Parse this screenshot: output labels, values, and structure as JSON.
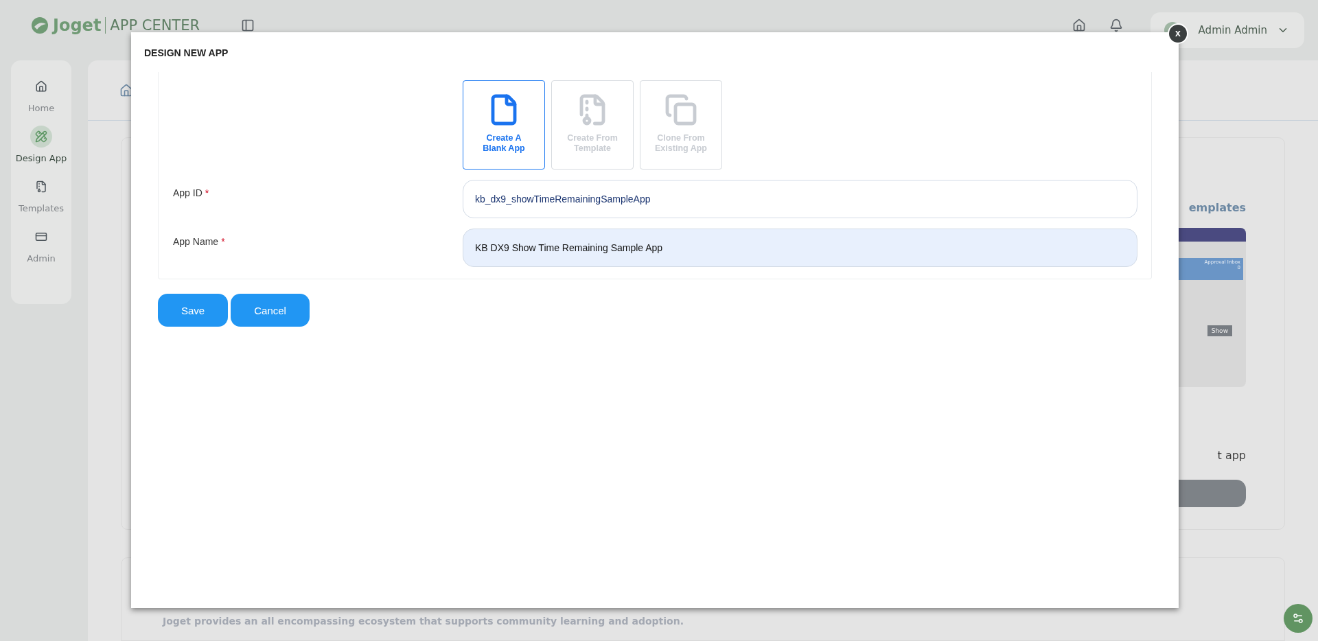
{
  "header": {
    "logo": "Joget",
    "title": "APP CENTER",
    "user": "Admin Admin"
  },
  "sidebar": {
    "items": [
      {
        "label": "Home",
        "selected": false
      },
      {
        "label": "Design App",
        "selected": true
      },
      {
        "label": "Templates",
        "selected": false
      },
      {
        "label": "Admin",
        "selected": false
      }
    ]
  },
  "background": {
    "templates_link": "emplates",
    "preview": {
      "tile_title": "Approval Inbox",
      "tile_count": "0",
      "button": "Show"
    },
    "card_title": "t app",
    "community_text": "Joget provides an all encompassing ecosystem that supports community learning and adoption."
  },
  "dialog": {
    "title": "DESIGN NEW APP",
    "close": "x",
    "options": [
      {
        "label": "Create A Blank App",
        "selected": true,
        "disabled": false
      },
      {
        "label": "Create From Template",
        "selected": false,
        "disabled": true
      },
      {
        "label": "Clone From Existing App",
        "selected": false,
        "disabled": true
      }
    ],
    "fields": [
      {
        "label": "App ID",
        "required_mark": "*",
        "value": "kb_dx9_showTimeRemainingSampleApp",
        "highlighted": false
      },
      {
        "label": "App Name",
        "required_mark": "*",
        "value": "KB DX9 Show Time Remaining Sample App",
        "highlighted": true
      }
    ],
    "buttons": [
      {
        "label": "Save"
      },
      {
        "label": "Cancel"
      }
    ]
  }
}
